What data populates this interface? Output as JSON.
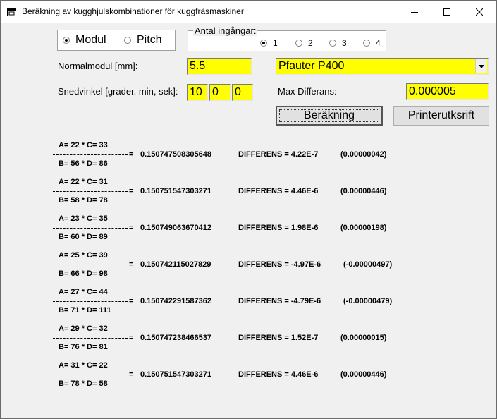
{
  "window": {
    "title": "Beräkning av kugghjulskombinationer för kuggfräsmaskiner"
  },
  "icons": {
    "app": "app-window-icon",
    "minimize": "minimize-icon",
    "maximize": "maximize-icon",
    "close": "close-icon",
    "dropdown": "chevron-down-icon"
  },
  "mode": {
    "options": [
      {
        "label": "Modul",
        "selected": true
      },
      {
        "label": "Pitch",
        "selected": false
      }
    ]
  },
  "inputs_group": {
    "title": "Antal ingångar:",
    "options": [
      {
        "label": "1",
        "selected": true
      },
      {
        "label": "2",
        "selected": false
      },
      {
        "label": "3",
        "selected": false
      },
      {
        "label": "4",
        "selected": false
      }
    ]
  },
  "form": {
    "normalmodul_label": "Normalmodul [mm]:",
    "normalmodul_value": "5.5",
    "machine_value": "Pfauter P400",
    "snedvinkel_label": "Snedvinkel [grader, min, sek]:",
    "snedvinkel_deg": "10",
    "snedvinkel_min": "0",
    "snedvinkel_sek": "0",
    "maxdiff_label": "Max Differans:",
    "maxdiff_value": "0.000005"
  },
  "buttons": {
    "calc": "Beräkning",
    "print": "Printerutksrift"
  },
  "colors": {
    "input_bg": "#ffff00",
    "window_bg": "#f0f0f0"
  },
  "results": [
    {
      "top": "A= 22  * C= 33",
      "eq": "=",
      "value": "0.150747508305648",
      "diff": "DIFFERENS = 4.22E-7",
      "paren": "(0.00000042)",
      "bottom": "B= 56  * D= 86"
    },
    {
      "top": "A= 22  * C= 31",
      "eq": "=",
      "value": "0.150751547303271",
      "diff": "DIFFERENS = 4.46E-6",
      "paren": "(0.00000446)",
      "bottom": "B= 58  * D= 78"
    },
    {
      "top": "A= 23  * C= 35",
      "eq": "=",
      "value": "0.150749063670412",
      "diff": "DIFFERENS = 1.98E-6",
      "paren": "(0.00000198)",
      "bottom": "B= 60  * D= 89"
    },
    {
      "top": "A= 25  * C= 39",
      "eq": "=",
      "value": "0.150742115027829",
      "diff": "DIFFERENS = -4.97E-6",
      "paren": "(-0.00000497)",
      "bottom": "B= 66  * D= 98"
    },
    {
      "top": "A= 27  * C= 44",
      "eq": "=",
      "value": "0.150742291587362",
      "diff": "DIFFERENS = -4.79E-6",
      "paren": "(-0.00000479)",
      "bottom": "B= 71  * D= 111"
    },
    {
      "top": "A= 29  * C= 32",
      "eq": "=",
      "value": "0.150747238466537",
      "diff": "DIFFERENS = 1.52E-7",
      "paren": "(0.00000015)",
      "bottom": "B= 76  * D= 81"
    },
    {
      "top": "A= 31  * C= 22",
      "eq": "=",
      "value": "0.150751547303271",
      "diff": "DIFFERENS = 4.46E-6",
      "paren": "(0.00000446)",
      "bottom": "B= 78  * D= 58"
    }
  ]
}
